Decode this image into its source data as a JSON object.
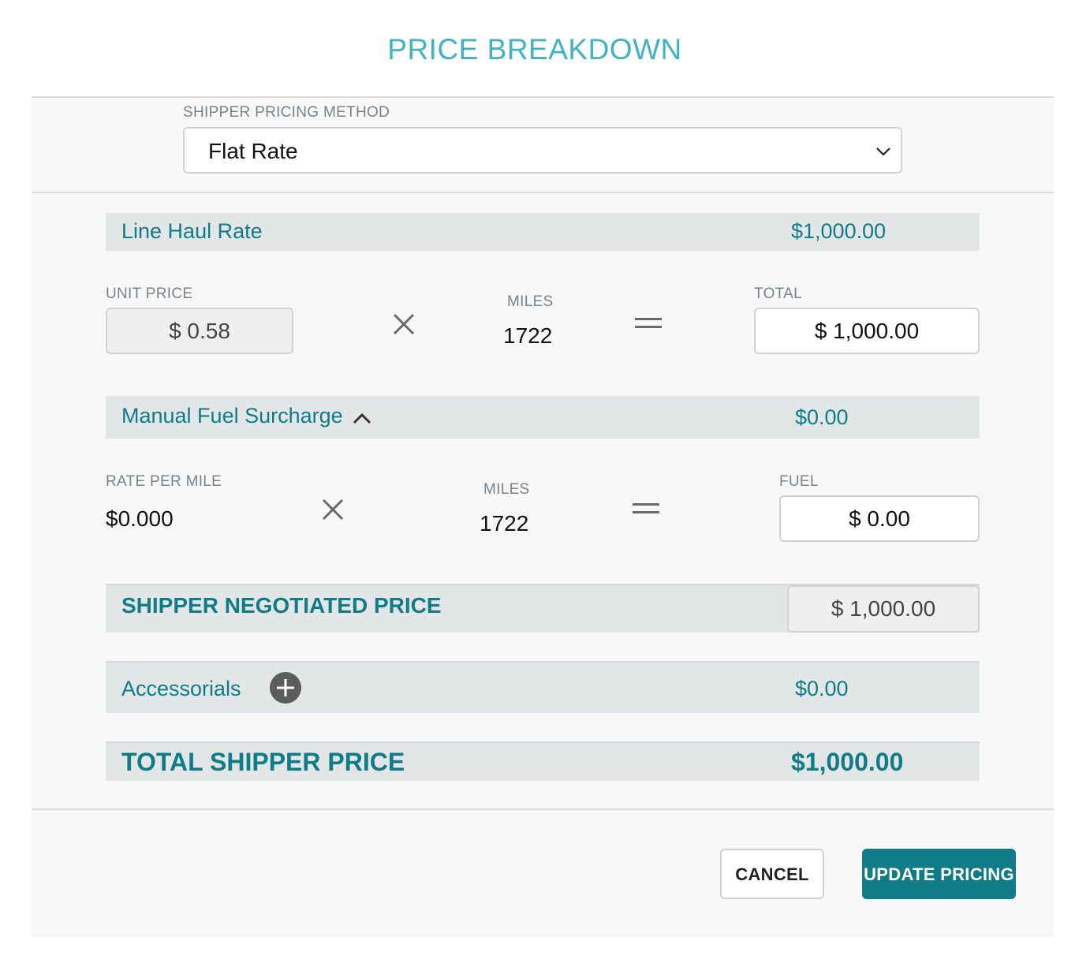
{
  "title": "PRICE BREAKDOWN",
  "pricing_method": {
    "label": "SHIPPER PRICING METHOD",
    "selected": "Flat Rate"
  },
  "line_haul": {
    "label": "Line Haul Rate",
    "amount": "$1,000.00",
    "unit_price_label": "UNIT PRICE",
    "unit_price": "$ 0.58",
    "miles_label": "MILES",
    "miles": "1722",
    "total_label": "TOTAL",
    "total": "$ 1,000.00"
  },
  "fuel": {
    "label": "Manual Fuel Surcharge",
    "amount": "$0.00",
    "rate_label": "RATE PER MILE",
    "rate": "$0.000",
    "miles_label": "MILES",
    "miles": "1722",
    "fuel_label": "FUEL",
    "fuel_value": "$ 0.00"
  },
  "negotiated": {
    "label": "SHIPPER NEGOTIATED PRICE",
    "value": "$ 1,000.00"
  },
  "accessorials": {
    "label": "Accessorials",
    "amount": "$0.00"
  },
  "total": {
    "label": "TOTAL SHIPPER PRICE",
    "amount": "$1,000.00"
  },
  "buttons": {
    "cancel": "CANCEL",
    "update": "UPDATE PRICING"
  },
  "icons": {
    "dropdown": "chevron-down-icon",
    "multiply": "multiply-icon",
    "equals": "equals-icon",
    "collapse": "chevron-up-icon",
    "add": "plus-circle-icon"
  },
  "colors": {
    "title": "#3fb3c2",
    "accent": "#0f7c87",
    "band": "#e3e6e7"
  }
}
